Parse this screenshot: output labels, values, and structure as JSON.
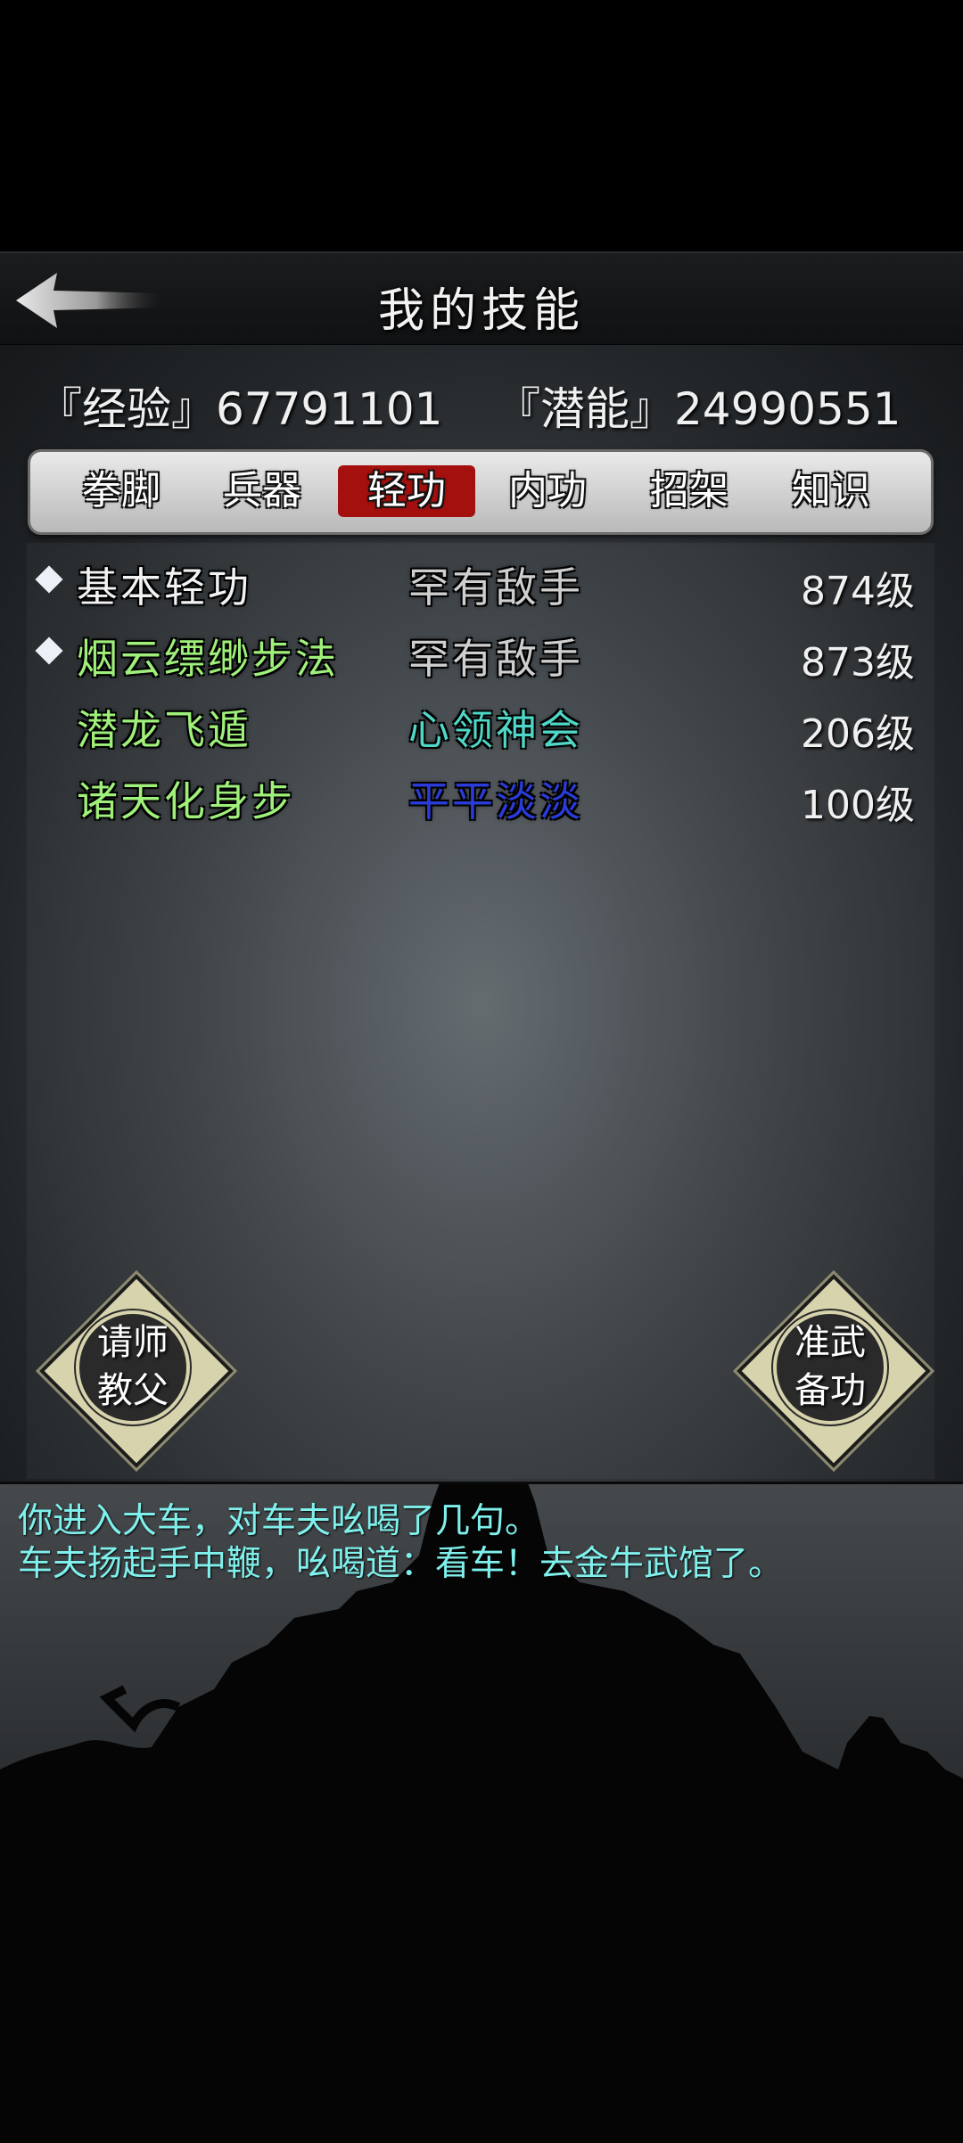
{
  "header": {
    "title": "我的技能"
  },
  "stats": {
    "exp_label": "『经验』",
    "exp_value": "67791101",
    "pot_label": "『潜能』",
    "pot_value": "24990551"
  },
  "tabs": [
    {
      "label": "拳脚",
      "active": false
    },
    {
      "label": "兵器",
      "active": false
    },
    {
      "label": "轻功",
      "active": true
    },
    {
      "label": "内功",
      "active": false
    },
    {
      "label": "招架",
      "active": false
    },
    {
      "label": "知识",
      "active": false
    }
  ],
  "skills": [
    {
      "name": "基本轻功",
      "grade": "罕有敌手",
      "level": "874级",
      "equipped": true,
      "name_color": "#f2f2f2",
      "grade_color": "#cfcfcf"
    },
    {
      "name": "烟云缥缈步法",
      "grade": "罕有敌手",
      "level": "873级",
      "equipped": true,
      "name_color": "#9ff07a",
      "grade_color": "#cfcfcf"
    },
    {
      "name": "潜龙飞遁",
      "grade": "心领神会",
      "level": "206级",
      "equipped": false,
      "name_color": "#9ff07a",
      "grade_color": "#4fd6c6"
    },
    {
      "name": "诸天化身步",
      "grade": "平平淡淡",
      "level": "100级",
      "equipped": false,
      "name_color": "#9ff07a",
      "grade_color": "#2a3bd8"
    }
  ],
  "buttons": {
    "master": {
      "line1": "请师",
      "line2": "教父"
    },
    "prepare": {
      "line1": "准武",
      "line2": "备功"
    }
  },
  "messages": [
    "你进入大车，对车夫吆喝了几句。",
    "车夫扬起手中鞭，吆喝道：看车！去金牛武馆了。"
  ],
  "colors": {
    "active_tab": "#a4100e",
    "message_text": "#7ff0ec"
  }
}
